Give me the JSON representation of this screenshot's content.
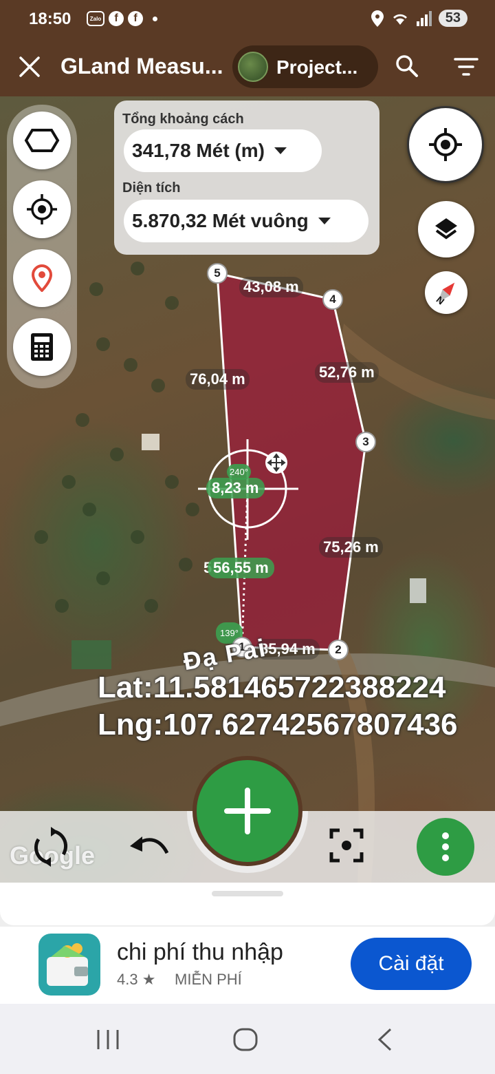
{
  "status_bar": {
    "time": "18:50",
    "notification_icons": [
      "zalo-icon",
      "facebook-icon",
      "facebook-icon"
    ],
    "zalo_text": "Zalo",
    "battery": "53"
  },
  "app_bar": {
    "title": "GLand Measu...",
    "project_label": "Project..."
  },
  "measurement": {
    "distance_label": "Tổng khoảng cách",
    "distance_value": "341,78 Mét (m)",
    "area_label": "Diện tích",
    "area_value": "5.870,32 Mét vuông"
  },
  "polygon": {
    "fill_color": "#a0193c",
    "vertices": [
      "1",
      "2",
      "3",
      "4",
      "5"
    ],
    "segment_labels": [
      "35,94 m",
      "75,26 m",
      "52,76 m",
      "43,08 m",
      "76,04 m"
    ]
  },
  "crosshair": {
    "distance": "8,23 m",
    "angle": "240°",
    "line_distance": "56,55 m",
    "line_distance_underlay": "5",
    "vertex_angle": "139°"
  },
  "map": {
    "road_name": "Đạ Pai",
    "lat": "Lat:11.581465722388224",
    "lng": "Lng:107.62742567807436",
    "attribution": "Google"
  },
  "ad": {
    "app_name": "chi phí thu nhập",
    "rating": "4.3 ★",
    "price": "MIỄN PHÍ",
    "install_label": "Cài đặt"
  },
  "colors": {
    "brand_brown": "#5a3a25",
    "fab_green": "#2e9c44",
    "install_blue": "#0b57d0"
  }
}
